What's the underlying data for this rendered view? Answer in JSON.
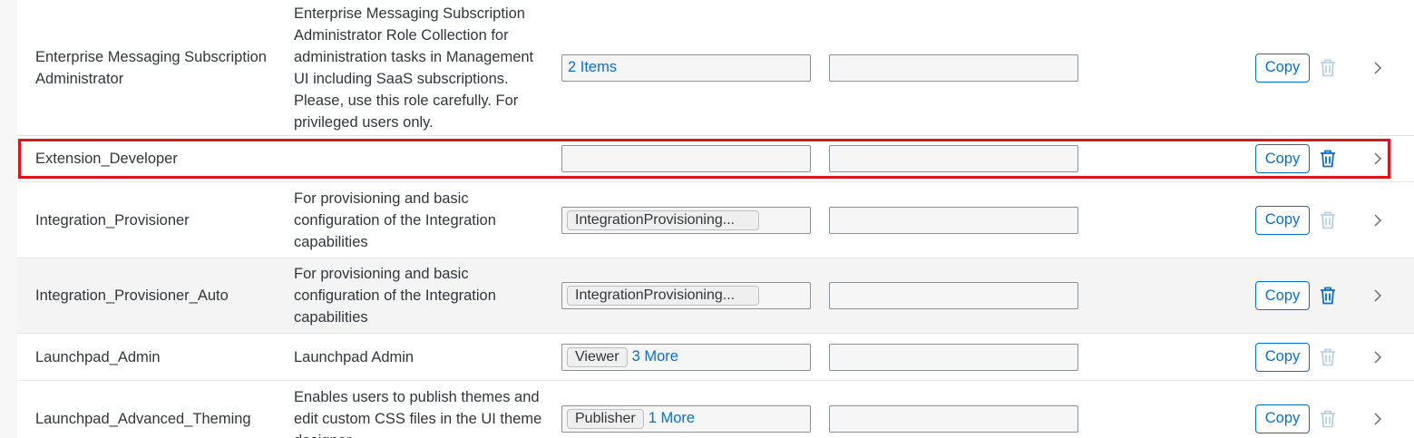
{
  "colors": {
    "link": "#0a6ed1",
    "highlight": "#e3111b",
    "trash_enabled": "#0a6ed1",
    "trash_disabled": "#b0cbe6"
  },
  "icons": {
    "delete": "trash-icon",
    "navigate": "chevron-right-icon"
  },
  "rows": [
    {
      "name": "Enterprise Messaging Subscription Administrator",
      "description": "Enterprise Messaging Subscription Administrator Role Collection for administration tasks in Management UI including SaaS subscriptions. Please, use this role carefully. For privileged users only.",
      "roles_link": "2 Items",
      "copy_label": "Copy",
      "delete_enabled": false
    },
    {
      "name": "Extension_Developer",
      "description": "",
      "copy_label": "Copy",
      "delete_enabled": true,
      "highlighted": true
    },
    {
      "name": "Integration_Provisioner",
      "description": "For provisioning and basic configuration of the Integration capabilities",
      "roles_token": "IntegrationProvisioning...",
      "copy_label": "Copy",
      "delete_enabled": false
    },
    {
      "name": "Integration_Provisioner_Auto",
      "description": "For provisioning and basic configuration of the Integration capabilities",
      "roles_token": "IntegrationProvisioning...",
      "copy_label": "Copy",
      "delete_enabled": true
    },
    {
      "name": "Launchpad_Admin",
      "description": "Launchpad Admin",
      "roles_token": "Viewer",
      "roles_link": "3 More",
      "copy_label": "Copy",
      "delete_enabled": false
    },
    {
      "name": "Launchpad_Advanced_Theming",
      "description": "Enables users to publish themes and edit custom CSS files in the UI theme designer",
      "roles_token": "Publisher",
      "roles_link": "1 More",
      "copy_label": "Copy",
      "delete_enabled": false
    }
  ]
}
